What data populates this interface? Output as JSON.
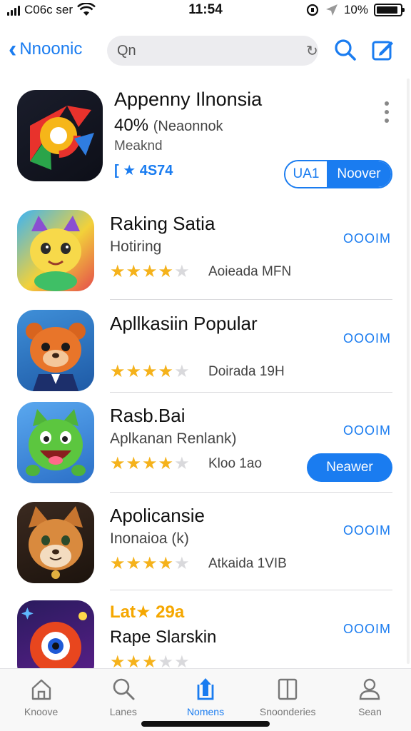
{
  "status_bar": {
    "carrier": "C06c ser",
    "time": "11:54",
    "battery_text": "10%",
    "battery_level": 0.9
  },
  "nav": {
    "back_label": "Nnoonic",
    "search_value": "Qn"
  },
  "featured": {
    "title": "Appenny Ilnonsia",
    "subtitle_main": "40%",
    "subtitle_small": "(Neaonnok",
    "category": "Meaknd",
    "rating_text": "[ ★ 4S74",
    "split_left_label": "UA1",
    "split_right_label": "Noover"
  },
  "apps": [
    {
      "name": "Raking Satia",
      "subtitle": "Hotiring",
      "rating": 4,
      "size": "Aoieada MFN",
      "get_label": "OOOIM"
    },
    {
      "name": "Apllkasiin Popular",
      "subtitle": "",
      "rating": 4,
      "size": "Doirada 19H",
      "get_label": "OOOIM"
    },
    {
      "name": "Rasb.Bai",
      "subtitle": "Aplkanan Renlank)",
      "rating": 4,
      "size": "Kloo 1ao",
      "get_label": "OOOIM",
      "button_label": "Neawer"
    },
    {
      "name": "Apolicansie",
      "subtitle": "Inonaioa (k)",
      "rating": 4,
      "size": "Atkaida 1VIB",
      "get_label": "OOOIM"
    },
    {
      "name": "Rape Slarskin",
      "tag": "Lat★ 29a",
      "rating": 3,
      "get_label": "OOOIM"
    }
  ],
  "tabs": [
    {
      "label": "Knoove",
      "icon": "home-icon"
    },
    {
      "label": "Lanes",
      "icon": "search-icon"
    },
    {
      "label": "Nomens",
      "icon": "upload-icon"
    },
    {
      "label": "Snoonderies",
      "icon": "book-icon"
    },
    {
      "label": "Sean",
      "icon": "person-icon"
    }
  ],
  "colors": {
    "accent": "#1a7cf0",
    "star": "#f5b21b",
    "tag_orange": "#f5a700"
  }
}
